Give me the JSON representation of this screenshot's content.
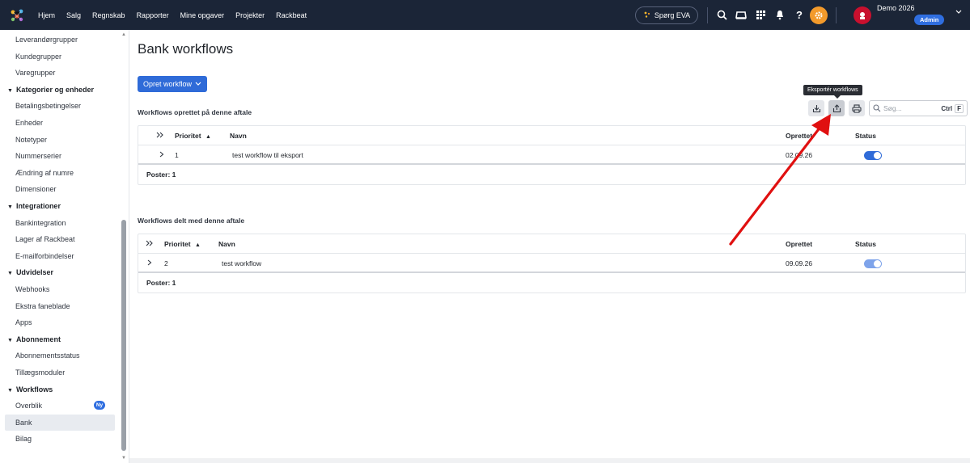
{
  "topbar": {
    "nav": [
      "Hjem",
      "Salg",
      "Regnskab",
      "Rapporter",
      "Mine opgaver",
      "Projekter",
      "Rackbeat"
    ],
    "eva_label": "Spørg EVA",
    "user_name": "Demo 2026",
    "user_role": "Admin"
  },
  "sidebar": {
    "items": [
      {
        "label": "Leverandørgrupper",
        "type": "item"
      },
      {
        "label": "Kundegrupper",
        "type": "item"
      },
      {
        "label": "Varegrupper",
        "type": "item"
      },
      {
        "label": "Kategorier og enheder",
        "type": "section"
      },
      {
        "label": "Betalingsbetingelser",
        "type": "item"
      },
      {
        "label": "Enheder",
        "type": "item"
      },
      {
        "label": "Notetyper",
        "type": "item"
      },
      {
        "label": "Nummerserier",
        "type": "item"
      },
      {
        "label": "Ændring af numre",
        "type": "item"
      },
      {
        "label": "Dimensioner",
        "type": "item"
      },
      {
        "label": "Integrationer",
        "type": "section"
      },
      {
        "label": "Bankintegration",
        "type": "item"
      },
      {
        "label": "Lager af Rackbeat",
        "type": "item"
      },
      {
        "label": "E-mailforbindelser",
        "type": "item"
      },
      {
        "label": "Udvidelser",
        "type": "section"
      },
      {
        "label": "Webhooks",
        "type": "item"
      },
      {
        "label": "Ekstra faneblade",
        "type": "item"
      },
      {
        "label": "Apps",
        "type": "item"
      },
      {
        "label": "Abonnement",
        "type": "section"
      },
      {
        "label": "Abonnementsstatus",
        "type": "item"
      },
      {
        "label": "Tillægsmoduler",
        "type": "item"
      },
      {
        "label": "Workflows",
        "type": "section"
      },
      {
        "label": "Overblik",
        "type": "item",
        "badge": "Ny"
      },
      {
        "label": "Bank",
        "type": "item",
        "active": true
      },
      {
        "label": "Bilag",
        "type": "item"
      }
    ]
  },
  "main": {
    "title": "Bank workflows",
    "create_button": "Opret workflow",
    "tooltip": "Eksportér workflows",
    "search_placeholder": "Søg...",
    "search_shortcut_ctrl": "Ctrl",
    "search_shortcut_key": "F",
    "section1": {
      "title": "Workflows oprettet på denne aftale",
      "headers": {
        "priority": "Prioritet",
        "name": "Navn",
        "created": "Oprettet",
        "status": "Status"
      },
      "rows": [
        {
          "priority": "1",
          "name": "test workflow til eksport",
          "created": "02.09.26",
          "status_on": true
        }
      ],
      "footer": "Poster: 1"
    },
    "section2": {
      "title": "Workflows delt med denne aftale",
      "headers": {
        "priority": "Prioritet",
        "name": "Navn",
        "created": "Oprettet",
        "status": "Status"
      },
      "rows": [
        {
          "priority": "2",
          "name": "test workflow",
          "created": "09.09.26",
          "status_on": true
        }
      ],
      "footer": "Poster: 1"
    }
  },
  "colors": {
    "topbar": "#1b2537",
    "accent": "#2f6bd8",
    "gear": "#f39a2b",
    "annotation_arrow": "#e01010"
  }
}
